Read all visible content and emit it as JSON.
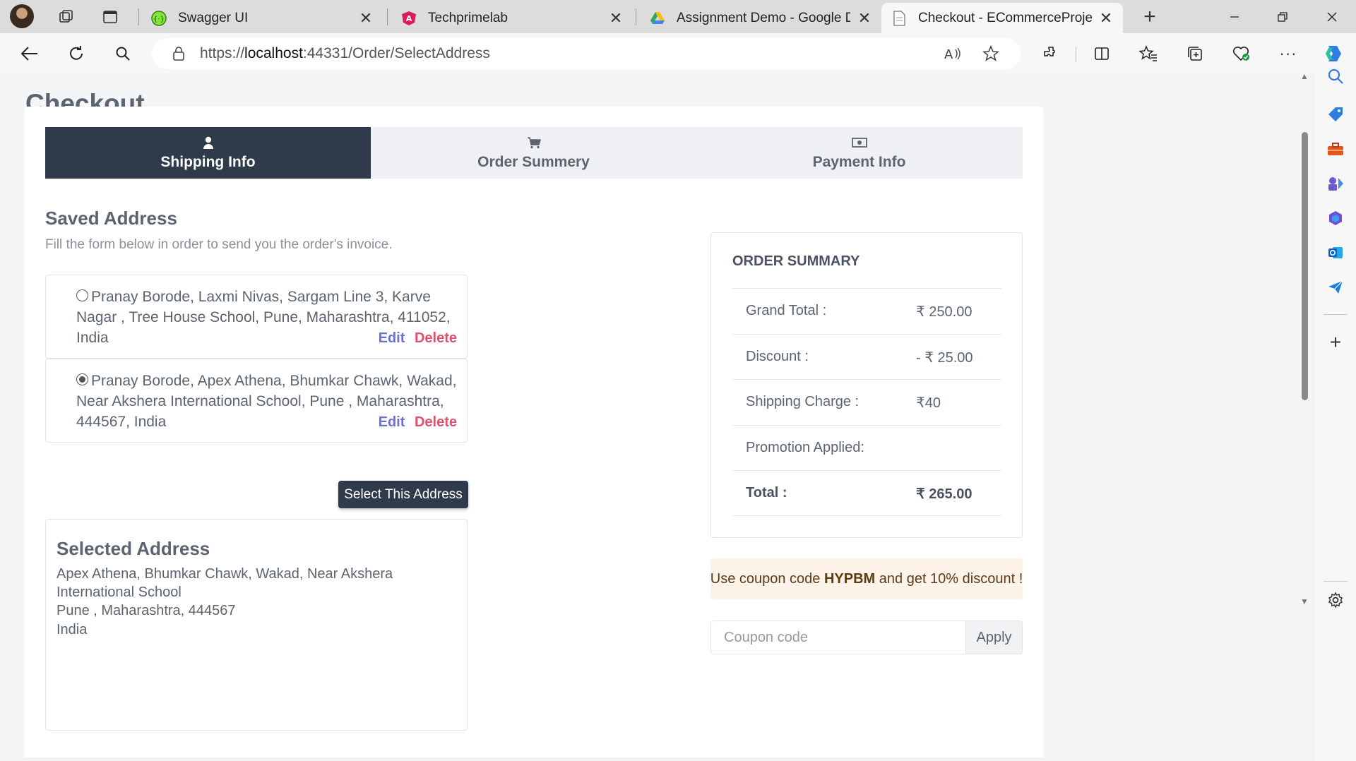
{
  "browser": {
    "tabs": [
      {
        "label": "Swagger UI",
        "favicon": "swagger-icon",
        "active": false
      },
      {
        "label": "Techprimelab",
        "favicon": "angular-icon",
        "active": false
      },
      {
        "label": "Assignment Demo - Google Dri",
        "favicon": "google-drive-icon",
        "active": false
      },
      {
        "label": "Checkout - ECommerceProject",
        "favicon": "page-icon",
        "active": true
      }
    ],
    "url_scheme": "https://",
    "url_host": "localhost",
    "url_rest": ":44331/Order/SelectAddress"
  },
  "page": {
    "title": "Checkout",
    "steps": [
      {
        "label": "Shipping Info",
        "icon": "user-icon",
        "active": true
      },
      {
        "label": "Order Summery",
        "icon": "cart-icon",
        "active": false
      },
      {
        "label": "Payment Info",
        "icon": "money-icon",
        "active": false
      }
    ],
    "saved_address": {
      "title": "Saved Address",
      "subtitle": "Fill the form below in order to send you the order's invoice.",
      "addresses": [
        {
          "text": "Pranay Borode, Laxmi Nivas, Sargam Line 3, Karve Nagar , Tree House School, Pune, Maharashtra, 411052, India",
          "checked": false
        },
        {
          "text": "Pranay Borode, Apex Athena, Bhumkar Chawk, Wakad, Near Akshera International School, Pune , Maharashtra, 444567, India",
          "checked": true
        }
      ],
      "edit_label": "Edit",
      "delete_label": "Delete",
      "select_button": "Select This Address"
    },
    "selected_address": {
      "title": "Selected Address",
      "line1": "Apex Athena, Bhumkar Chawk, Wakad, Near Akshera International School",
      "line2": "Pune , Maharashtra, 444567",
      "line3": "India"
    },
    "order_summary": {
      "title": "ORDER SUMMARY",
      "rows": [
        {
          "label": "Grand Total :",
          "value": "₹ 250.00"
        },
        {
          "label": "Discount :",
          "value": "- ₹ 25.00"
        },
        {
          "label": "Shipping Charge :",
          "value": "₹40"
        },
        {
          "label": "Promotion Applied:",
          "value": ""
        },
        {
          "label": "Total :",
          "value": "₹ 265.00"
        }
      ]
    },
    "coupon": {
      "banner_prefix": "Use coupon code ",
      "code": "HYPBM",
      "banner_suffix": " and get 10% discount !",
      "input_placeholder": "Coupon code",
      "apply_label": "Apply"
    }
  },
  "colors": {
    "dark": "#2f3a4a",
    "edit": "#6c6fd8",
    "delete": "#e0506c",
    "banner_bg": "#fdf3e8"
  }
}
